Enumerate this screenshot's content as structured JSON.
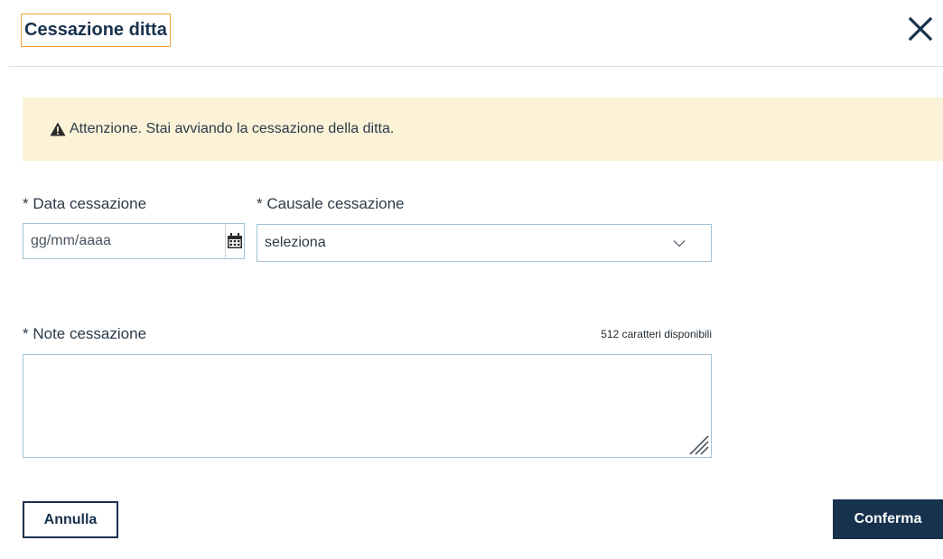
{
  "modal": {
    "title": "Cessazione ditta",
    "close_icon": "close-icon"
  },
  "alert": {
    "icon": "warning-icon",
    "text": "Attenzione. Stai avviando la cessazione della ditta.",
    "background_color": "#fbf2d8"
  },
  "form": {
    "date_field": {
      "label": "* Data cessazione",
      "placeholder": "gg/mm/aaaa",
      "value": "",
      "icon": "calendar-icon"
    },
    "causale_field": {
      "label": "* Causale cessazione",
      "selected": "seleziona",
      "icon": "chevron-down-icon"
    },
    "notes_field": {
      "label": "* Note cessazione",
      "counter": "512 caratteri disponibili",
      "value": "",
      "icon": "resize-handle-icon"
    }
  },
  "actions": {
    "cancel_label": "Annulla",
    "confirm_label": "Conferma",
    "primary_color": "#17324d"
  }
}
